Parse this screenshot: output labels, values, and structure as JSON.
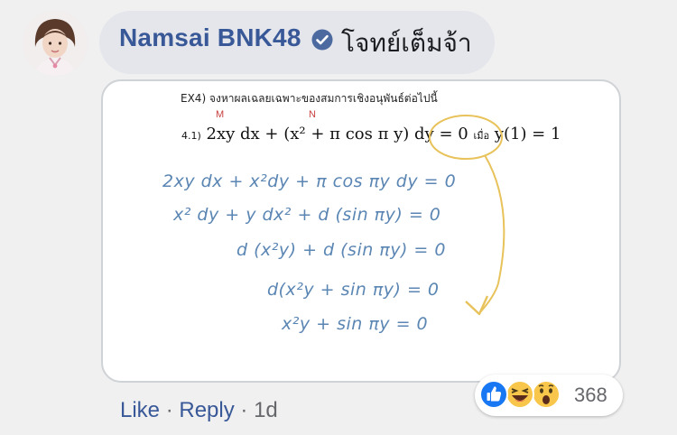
{
  "comment": {
    "author": "Namsai BNK48",
    "text": "โจทย์เต็มจ้า",
    "verified_icon": "verified-badge-icon",
    "accent_color": "#385898"
  },
  "attachment": {
    "problem_title": "EX4) จงหาผลเฉลยเฉพาะของสมการเชิงอนุพันธ์ต่อไปนี้",
    "problem_number": "4.1)",
    "problem_equation": "2xy dx + (x² + π cos π y) dy = 0",
    "condition_word": "เมื่อ",
    "condition": "y(1) = 1",
    "annot_m": "M",
    "annot_n": "N",
    "steps": [
      "2xy dx + x²dy + π cos πy dy = 0",
      "x² dy + y dx² + d (sin πy) = 0",
      "d (x²y) + d (sin πy) = 0",
      "d(x²y + sin πy) = 0",
      "x²y + sin πy = 0"
    ],
    "ink_color": "#5b86b3",
    "highlight_color": "#e8c25a"
  },
  "actions": {
    "like": "Like",
    "sep": "·",
    "reply": "Reply",
    "time": "1d"
  },
  "reactions": {
    "icons": [
      "like-icon",
      "haha-icon",
      "wow-icon"
    ],
    "count": "368"
  }
}
